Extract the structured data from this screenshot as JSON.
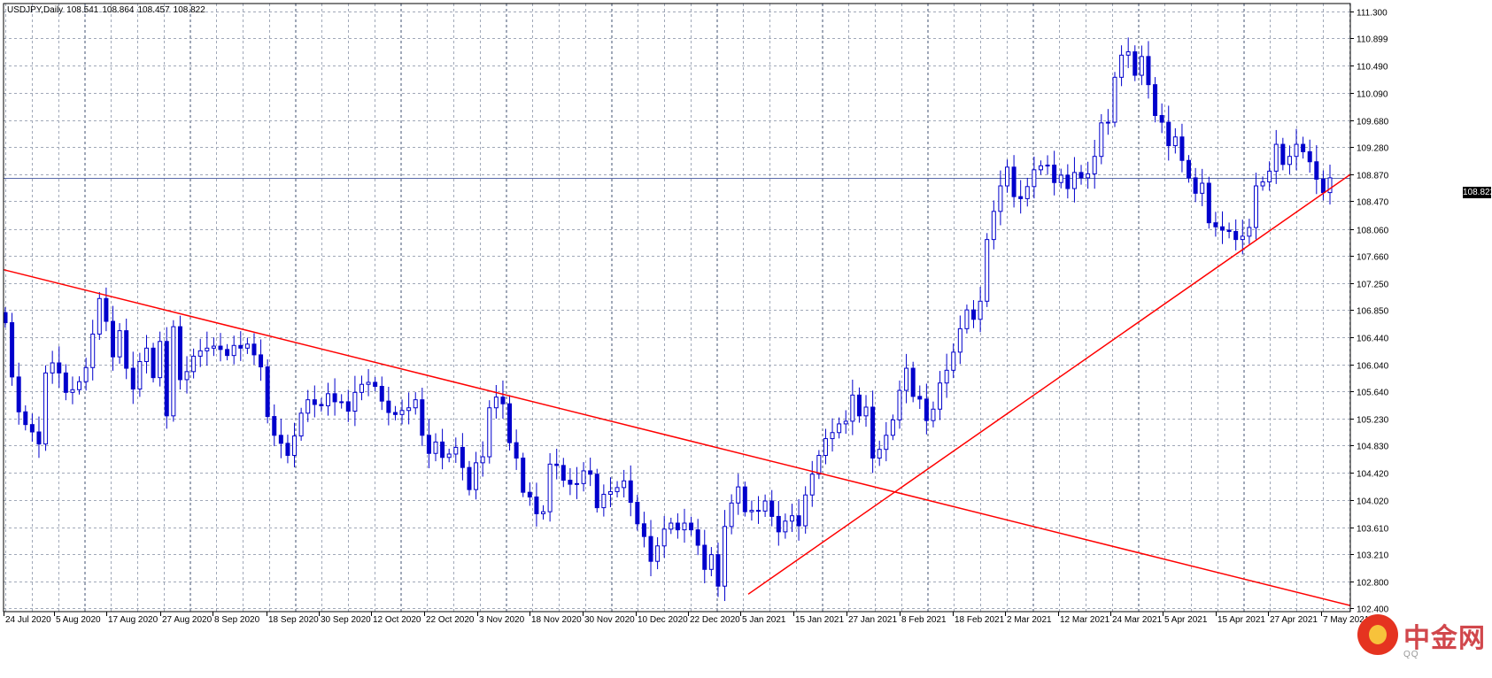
{
  "header": {
    "symbol": "USDJPY,Daily",
    "open": "108.541",
    "high": "108.864",
    "low": "108.457",
    "close": "108.822"
  },
  "last_price_label": "108.822",
  "watermark": {
    "text": "中金网",
    "subtext": "QQ"
  },
  "colors": {
    "candle": "#0000cc",
    "trendline": "#ff0000",
    "grid": "#a0a8b8",
    "price_line": "#5a6aaa",
    "watermark_red": "#e53320"
  },
  "chart_data": {
    "type": "candlestick",
    "title": "USDJPY,Daily",
    "ylim": [
      102.35,
      111.42
    ],
    "grid": true,
    "y_ticks": [
      "111.300",
      "110.899",
      "110.490",
      "110.090",
      "109.680",
      "109.280",
      "108.870",
      "108.470",
      "108.060",
      "107.660",
      "107.250",
      "106.850",
      "106.440",
      "106.040",
      "105.640",
      "105.230",
      "104.830",
      "104.420",
      "104.020",
      "103.610",
      "103.210",
      "102.800",
      "102.400"
    ],
    "x_tick_labels": [
      "24 Jul 2020",
      "5 Aug 2020",
      "17 Aug 2020",
      "27 Aug 2020",
      "8 Sep 2020",
      "18 Sep 2020",
      "30 Sep 2020",
      "12 Oct 2020",
      "22 Oct 2020",
      "3 Nov 2020",
      "18 Nov 2020",
      "30 Nov 2020",
      "10 Dec 2020",
      "22 Dec 2020",
      "5 Jan 2021",
      "15 Jan 2021",
      "27 Jan 2021",
      "8 Feb 2021",
      "18 Feb 2021",
      "2 Mar 2021",
      "12 Mar 2021",
      "24 Mar 2021",
      "5 Apr 2021",
      "15 Apr 2021",
      "27 Apr 2021",
      "7 May 2021"
    ],
    "last_price": 108.822,
    "closes": [
      106.66,
      105.85,
      105.33,
      105.14,
      105.03,
      104.85,
      105.91,
      106.06,
      105.91,
      105.62,
      105.66,
      105.78,
      105.99,
      106.49,
      107.02,
      106.68,
      106.15,
      106.54,
      105.98,
      105.67,
      106.08,
      106.28,
      105.84,
      106.38,
      105.27,
      106.6,
      105.81,
      105.93,
      106.16,
      106.24,
      106.28,
      106.31,
      106.26,
      106.17,
      106.32,
      106.28,
      106.34,
      106.18,
      106.0,
      105.26,
      104.98,
      104.86,
      104.68,
      104.97,
      105.31,
      105.51,
      105.44,
      105.42,
      105.6,
      105.48,
      105.48,
      105.34,
      105.62,
      105.74,
      105.77,
      105.71,
      105.49,
      105.32,
      105.29,
      105.35,
      105.39,
      105.51,
      104.98,
      104.71,
      104.88,
      104.65,
      104.7,
      104.8,
      104.5,
      104.17,
      104.57,
      104.66,
      105.39,
      105.55,
      105.45,
      104.87,
      104.64,
      104.13,
      104.06,
      103.81,
      103.84,
      104.55,
      104.53,
      104.31,
      104.25,
      104.26,
      104.45,
      104.4,
      103.9,
      104.1,
      104.14,
      104.2,
      104.3,
      103.98,
      103.66,
      103.47,
      103.1,
      103.33,
      103.58,
      103.67,
      103.57,
      103.67,
      103.57,
      103.34,
      102.98,
      103.2,
      102.73,
      103.62,
      103.97,
      104.21,
      103.84,
      103.86,
      103.85,
      104.0,
      103.77,
      103.54,
      103.7,
      103.78,
      103.63,
      104.09,
      104.4,
      104.68,
      104.93,
      105.02,
      105.15,
      105.19,
      105.58,
      105.27,
      105.4,
      104.64,
      104.77,
      104.98,
      105.21,
      105.65,
      105.98,
      105.56,
      105.52,
      105.2,
      105.37,
      105.76,
      105.95,
      106.22,
      106.57,
      106.85,
      106.71,
      106.98,
      107.9,
      108.32,
      108.7,
      108.98,
      108.54,
      108.51,
      108.69,
      108.94,
      109.0,
      109.01,
      108.75,
      108.86,
      108.66,
      108.9,
      108.82,
      108.88,
      109.14,
      109.64,
      109.65,
      110.32,
      110.65,
      110.7,
      110.35,
      110.63,
      110.21,
      109.75,
      109.65,
      109.3,
      109.43,
      109.08,
      108.82,
      108.59,
      108.74,
      108.15,
      108.09,
      108.04,
      108.02,
      107.9,
      107.95,
      108.08,
      108.7,
      108.76,
      108.92,
      109.32,
      109.02,
      109.14,
      109.32,
      109.21,
      109.06,
      108.8,
      108.6,
      108.82
    ],
    "series": [
      {
        "name": "trendline",
        "x": [
          "Jul 2020",
          "May 2021"
        ],
        "values": [
          107.45,
          102.44
        ]
      },
      {
        "name": "trendline",
        "x": [
          "6 Jan 2021",
          "May 2021"
        ],
        "values": [
          102.61,
          108.87
        ]
      }
    ]
  }
}
